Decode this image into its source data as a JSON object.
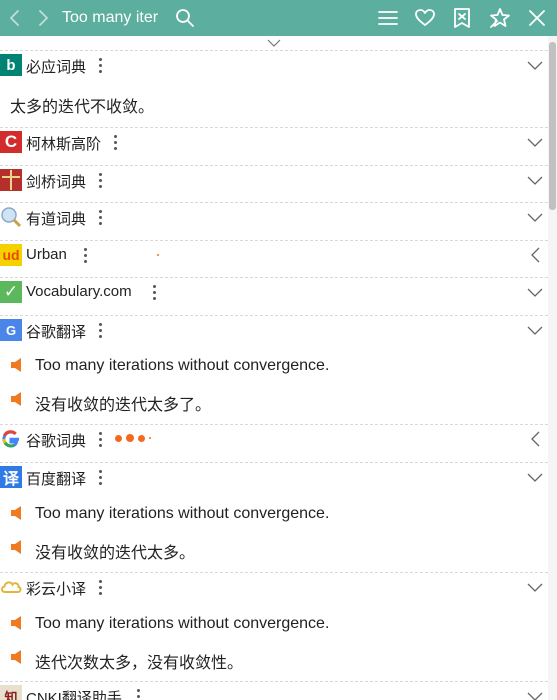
{
  "toolbar": {
    "search_value": "Too many iter",
    "icons": {
      "back": "chevron-left-icon",
      "forward": "chevron-right-icon",
      "search": "search-icon",
      "menu": "hamburger-menu-icon",
      "favorite": "heart-icon",
      "wordbook": "book-icon",
      "pin": "pin-star-icon",
      "close": "close-icon"
    }
  },
  "colors": {
    "header_bg": "#5caf9e",
    "speaker": "#f07a22",
    "loading": "#f26a1f"
  },
  "dicts": {
    "bing": {
      "title": "必应词典",
      "result": "太多的迭代不收敛。"
    },
    "collins": {
      "title": "柯林斯高阶"
    },
    "cambridge": {
      "title": "剑桥词典"
    },
    "youdao": {
      "title": "有道词典"
    },
    "urban": {
      "title": "Urban"
    },
    "vocabulary": {
      "title": "Vocabulary.com"
    },
    "google_trans": {
      "title": "谷歌翻译",
      "source": "Too many iterations without convergence.",
      "target": "没有收敛的迭代太多了。"
    },
    "google_dict": {
      "title": "谷歌词典"
    },
    "baidu": {
      "title": "百度翻译",
      "source": "Too many iterations without convergence.",
      "target": "没有收敛的迭代太多。"
    },
    "caiyun": {
      "title": "彩云小译",
      "source": "Too many iterations without convergence.",
      "target": "迭代次数太多，没有收敛性。"
    },
    "cnki": {
      "title": "CNKI翻译助手"
    }
  }
}
